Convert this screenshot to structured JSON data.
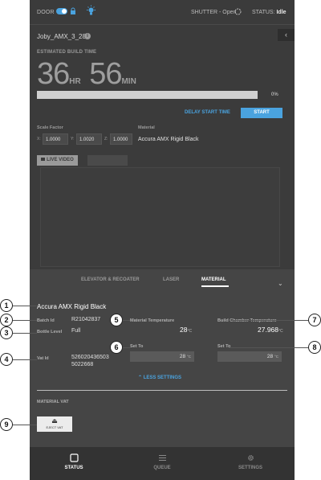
{
  "topbar": {
    "door_label": "DOOR",
    "shutter_text": "SHUTTER - Open",
    "status_prefix": "STATUS:",
    "status_value": "Idle"
  },
  "job": {
    "name": "Joby_AMX_3_28",
    "estimated_label": "ESTIMATED BUILD TIME",
    "hours": "36",
    "hours_unit": "HR",
    "minutes": "56",
    "minutes_unit": "MIN",
    "progress_percent_text": "0%",
    "progress_fraction": 0,
    "delay_label": "DELAY START TIME",
    "start_label": "START"
  },
  "scale": {
    "label": "Scale Factor",
    "x_label": "X:",
    "x_value": "1.0000",
    "y_label": "Y:",
    "y_value": "1.0020",
    "z_label": "Z:",
    "z_value": "1.0000"
  },
  "material_info": {
    "label": "Material",
    "value": "Accura AMX Rigid Black"
  },
  "video": {
    "live_label": "LIVE VIDEO"
  },
  "panel": {
    "tabs": [
      {
        "label": "ELEVATOR & RECOATER"
      },
      {
        "label": "LASER"
      },
      {
        "label": "MATERIAL"
      }
    ],
    "material_name": "Accura AMX Rigid Black",
    "batch_label": "Batch Id",
    "batch_value": "R21042837",
    "bottle_label": "Bottle Level",
    "bottle_value": "Full",
    "vat_label": "Vat Id",
    "vat_value_line1": "526020436503",
    "vat_value_line2": "5022668",
    "mat_temp_label": "Material Temperature",
    "mat_temp_value": "28",
    "chamber_temp_label": "Build Chamber Temperature",
    "chamber_temp_value": "27.968",
    "temp_unit": "°C",
    "set_to_label": "Set To",
    "set_mat_value": "28",
    "set_chamber_value": "28",
    "less_settings": "LESS SETTINGS",
    "material_vat_label": "MATERIAL VAT",
    "eject_label": "EJECT VAT"
  },
  "nav": {
    "items": [
      {
        "label": "STATUS",
        "icon": "square-icon"
      },
      {
        "label": "QUEUE",
        "icon": "list-icon"
      },
      {
        "label": "SETTINGS",
        "icon": "gear-icon"
      }
    ]
  },
  "callouts": [
    "1",
    "2",
    "3",
    "4",
    "5",
    "6",
    "7",
    "8",
    "9"
  ],
  "colors": {
    "accent": "#4aa3df",
    "background": "#3b3b3b",
    "panel": "#454545"
  }
}
